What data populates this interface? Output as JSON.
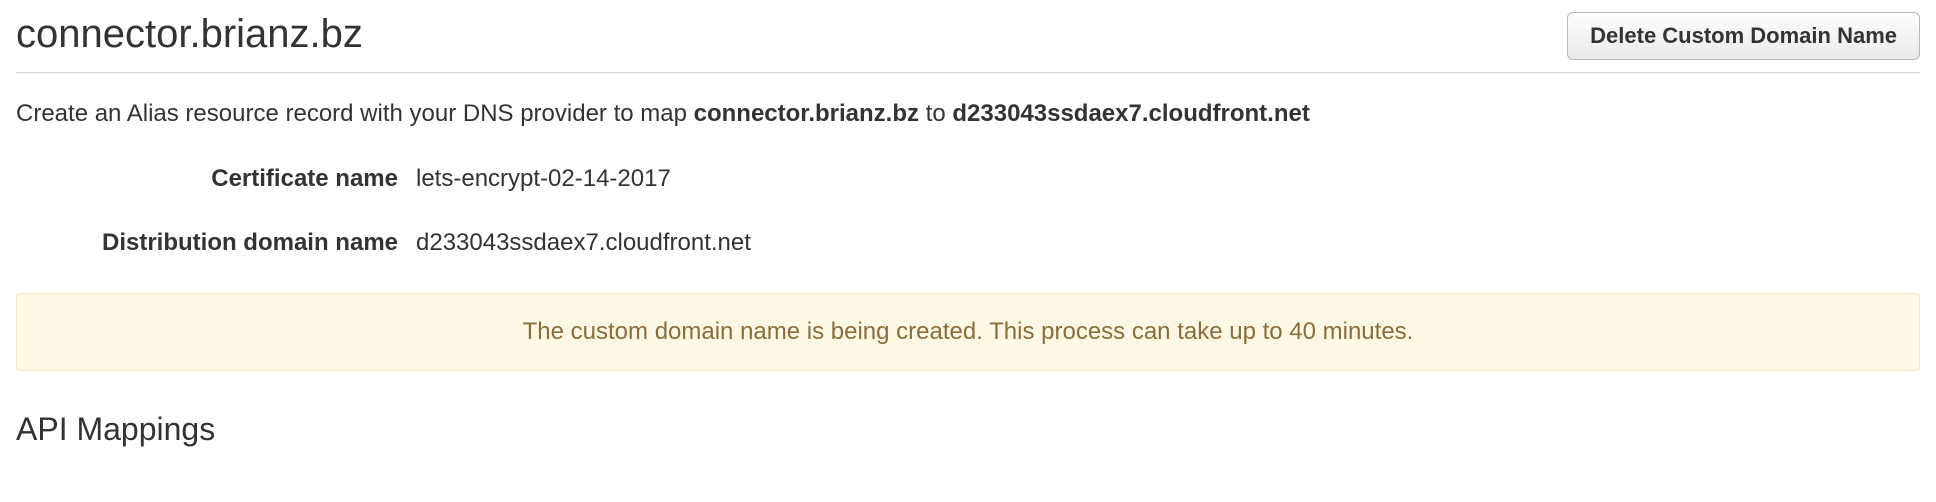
{
  "header": {
    "title": "connector.brianz.bz",
    "delete_button_label": "Delete Custom Domain Name"
  },
  "instruction": {
    "prefix": "Create an Alias resource record with your DNS provider to map ",
    "domain": "connector.brianz.bz",
    "middle": " to ",
    "target": "d233043ssdaex7.cloudfront.net"
  },
  "fields": {
    "certificate_label": "Certificate name",
    "certificate_value": "lets-encrypt-02-14-2017",
    "distribution_label": "Distribution domain name",
    "distribution_value": "d233043ssdaex7.cloudfront.net"
  },
  "alert": {
    "message": "The custom domain name is being created. This process can take up to 40 minutes."
  },
  "section": {
    "api_mappings_heading": "API Mappings"
  }
}
